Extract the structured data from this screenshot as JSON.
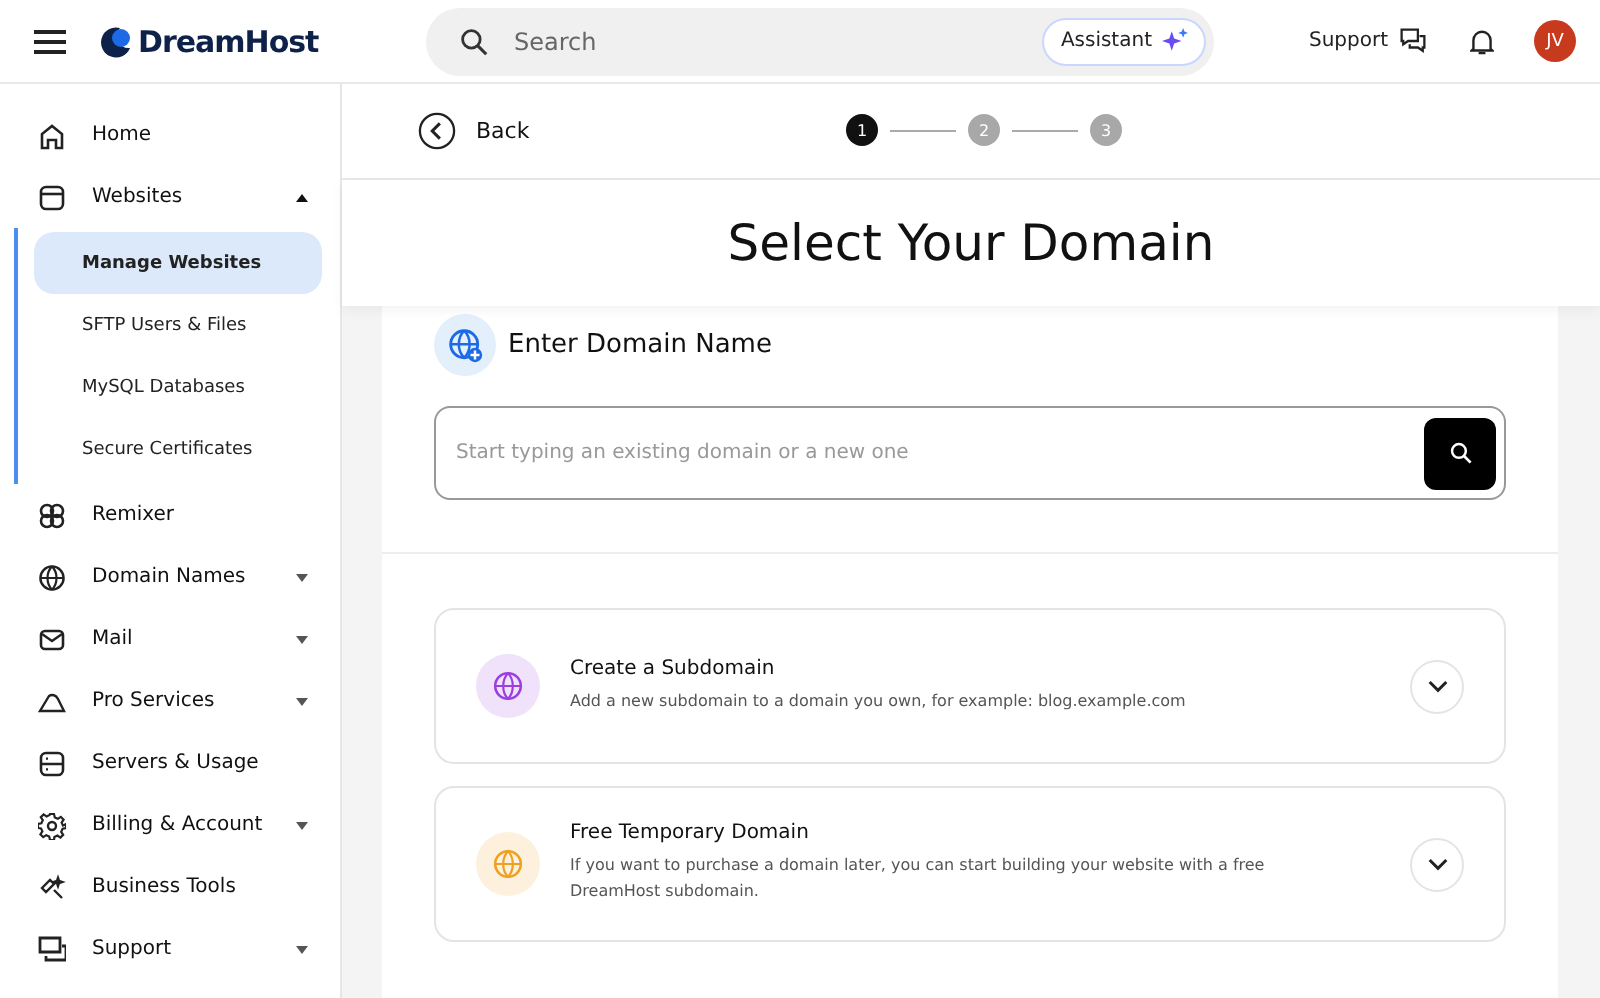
{
  "header": {
    "brand": "DreamHost",
    "search": {
      "placeholder": "Search"
    },
    "assistant": "Assistant",
    "support": "Support",
    "avatar": "JV"
  },
  "sidebar": {
    "items": [
      {
        "label": "Home"
      },
      {
        "label": "Websites",
        "expanded": true,
        "children": [
          {
            "label": "Manage Websites",
            "selected": true
          },
          {
            "label": "SFTP Users & Files",
            "selected": false
          },
          {
            "label": "MySQL Databases",
            "selected": false
          },
          {
            "label": "Secure Certificates",
            "selected": false
          }
        ]
      },
      {
        "label": "Remixer"
      },
      {
        "label": "Domain Names",
        "expanded": false
      },
      {
        "label": "Mail",
        "expanded": false
      },
      {
        "label": "Pro Services",
        "expanded": false
      },
      {
        "label": "Servers & Usage"
      },
      {
        "label": "Billing & Account",
        "expanded": false
      },
      {
        "label": "Business Tools"
      },
      {
        "label": "Support",
        "expanded": false
      }
    ]
  },
  "topbar": {
    "back": "Back",
    "steps": [
      {
        "label": "1",
        "selected": true
      },
      {
        "label": "2",
        "selected": false
      },
      {
        "label": "3",
        "selected": false
      }
    ]
  },
  "title": "Select Your Domain",
  "domain_entry": {
    "heading": "Enter Domain Name",
    "placeholder": "Start typing an existing domain or a new one"
  },
  "options": [
    {
      "title": "Create a Subdomain",
      "description": "Add a new subdomain to a domain you own, for example: blog.example.com",
      "color": "#9b3fe0",
      "expanded": false
    },
    {
      "title": "Free Temporary Domain",
      "description": "If you want to purchase a domain later, you can start building your website with a free DreamHost subdomain.",
      "color": "#f0a020",
      "expanded": false
    }
  ]
}
